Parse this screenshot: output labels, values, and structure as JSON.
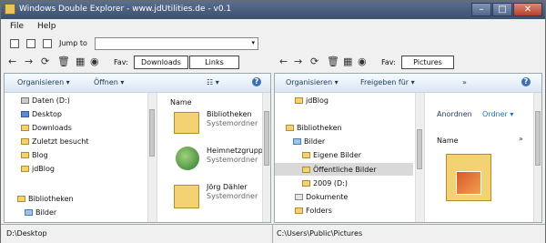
{
  "window": {
    "title": "Windows Double Explorer - www.jdUtilities.de - v0.1"
  },
  "menu": [
    "File",
    "Help"
  ],
  "jump": {
    "label": "Jump to"
  },
  "left": {
    "fav_label": "Fav:",
    "tabs": [
      "Downloads",
      "Links"
    ],
    "commands": {
      "organize": "Organisieren ▾",
      "open": "Öffnen ▾",
      "views": "☷ ▾"
    },
    "tree": [
      "Daten (D:)",
      "Desktop",
      "Downloads",
      "Zuletzt besucht",
      "Blog",
      "jdBlog",
      "Bibliotheken",
      "Bilder"
    ],
    "files": {
      "column": "Name",
      "items": [
        {
          "name": "Bibliotheken",
          "type": "Systemordner"
        },
        {
          "name": "Heimnetzgruppe",
          "type": "Systemordner"
        },
        {
          "name": "Jörg Dähler",
          "type": "Systemordner"
        }
      ]
    },
    "status": "D:\\Desktop"
  },
  "right": {
    "fav_label": "Fav:",
    "tabs": [
      "Pictures"
    ],
    "commands": {
      "organize": "Organisieren ▾",
      "share": "Freigeben für ▾",
      "more": "»"
    },
    "tree": [
      "jdBlog",
      "Bibliotheken",
      "Bilder",
      "Eigene Bilder",
      "Öffentliche Bilder",
      "2009 (D:)",
      "Dokumente",
      "Folders"
    ],
    "files": {
      "arrange": "Anordnen",
      "arrange_value": "Ordner ▾",
      "column": "Name"
    },
    "status": "C:\\Users\\Public\\Pictures"
  },
  "colors": {
    "title_bar": "#3b4f6e",
    "command_bar": "#dbe6f3",
    "folder": "#f2d273"
  }
}
